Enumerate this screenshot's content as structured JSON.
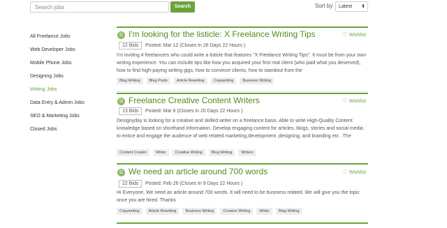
{
  "search": {
    "placeholder": "Search jobs",
    "button_label": "Search"
  },
  "sort": {
    "label": "Sort by",
    "selected": "Latest"
  },
  "sidebar": {
    "items": [
      {
        "label": "All Freelance Jobs",
        "active": false
      },
      {
        "label": "Web Developer Jobs",
        "active": false
      },
      {
        "label": "Mobile Phone Jobs",
        "active": false
      },
      {
        "label": "Designing Jobs",
        "active": false
      },
      {
        "label": "Writing Jobs",
        "active": true
      },
      {
        "label": "Data Entry & Admin Jobs",
        "active": false
      },
      {
        "label": "SEO & Marketing Jobs",
        "active": false
      },
      {
        "label": "Closed Jobs",
        "active": false
      }
    ]
  },
  "jobs": [
    {
      "title": "I'm looking for the listicle: X Freelance Writing Tips",
      "wishlist": "Wishlist",
      "bids": "12 Bids",
      "posted": "Posted: Mar 12 (Closes In 26 Days 22 Hours )",
      "description": "I'm inviting 4 freelancers who could write a listicle that features \"X Freelance Writing Tips\". It must be from your own writing experience. You can include tips like how you acquired your first real client (who paid what you deserved), how to find high-paying writing gigs, how to convince clients, how to standout from the",
      "tags": [
        "Blog Writing",
        "Blog Posts",
        "Article Rewriting",
        "Copywriting",
        "Business Writing"
      ]
    },
    {
      "title": "Freelance Creative Content Writers",
      "wishlist": "Wishlist",
      "bids": "13 Bids",
      "posted": "Posted: Mar 6 (Closes In 20 Days 22 Hours )",
      "description": "Designyday is looking for a creative and skilled writer on a freelance basis. Able to write High-Quality Content knowledge based on shorthand information. Develop engaging content for articles, blogs, stories and social media to entice and engage the audience of web related marketing,development ,designing, and branding etc . The",
      "tags": [
        "Content Creator",
        "Writer",
        "Creative Writing",
        "Blog Writing",
        "Writers"
      ]
    },
    {
      "title": "We need an article around 700 words",
      "wishlist": "Wishlist",
      "bids": "22 Bids",
      "posted": "Posted: Feb 26 (Closes In 9 Days 22 Hours )",
      "description": "Hi Everyone, We need an article around 700 words. It will need to be business related. We will give you the topic once you are hired. Thanks",
      "tags": [
        "Copywriting",
        "Article Rewriting",
        "Business Writing",
        "Creative Writing",
        "Writer",
        "Blog Writing"
      ]
    }
  ],
  "colors": {
    "accent": "#6aa33b",
    "title": "#4f8d1e",
    "tag_bg": "#eeeeee"
  },
  "icons": {
    "job": "job-circle-icon",
    "wishlist": "heart-icon",
    "sort": "chevron-down-icon"
  }
}
